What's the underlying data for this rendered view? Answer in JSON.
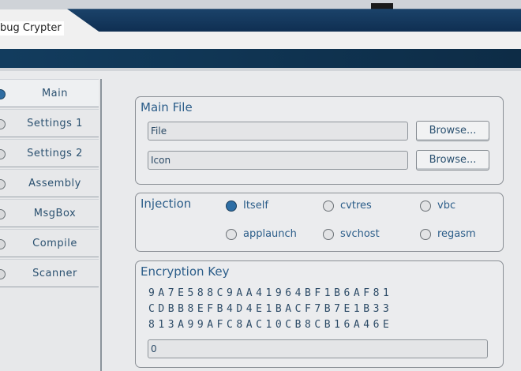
{
  "window": {
    "title": "bug Crypter"
  },
  "sidebar": {
    "items": [
      {
        "label": "Main",
        "active": true
      },
      {
        "label": "Settings 1",
        "active": false
      },
      {
        "label": "Settings 2",
        "active": false
      },
      {
        "label": "Assembly",
        "active": false
      },
      {
        "label": "MsgBox",
        "active": false
      },
      {
        "label": "Compile",
        "active": false
      },
      {
        "label": "Scanner",
        "active": false
      }
    ]
  },
  "main_file": {
    "title": "Main File",
    "file_value": "File",
    "icon_value": "Icon",
    "browse_label": "Browse..."
  },
  "injection": {
    "title": "Injection",
    "options": [
      "Itself",
      "cvtres",
      "vbc",
      "applaunch",
      "svchost",
      "regasm"
    ],
    "selected": "Itself"
  },
  "encryption": {
    "title": "Encryption Key",
    "rows": [
      "9A7E588C9AA41964BF1B6AF81",
      "CDBB8EFB4D4E1BACF7B7E1B33",
      "813A99AFC8AC10CB8CB16A46E"
    ],
    "field_value": "0"
  },
  "colors": {
    "accent": "#2e6ea5",
    "banner": "#123c5e",
    "text": "#2b5d89"
  }
}
